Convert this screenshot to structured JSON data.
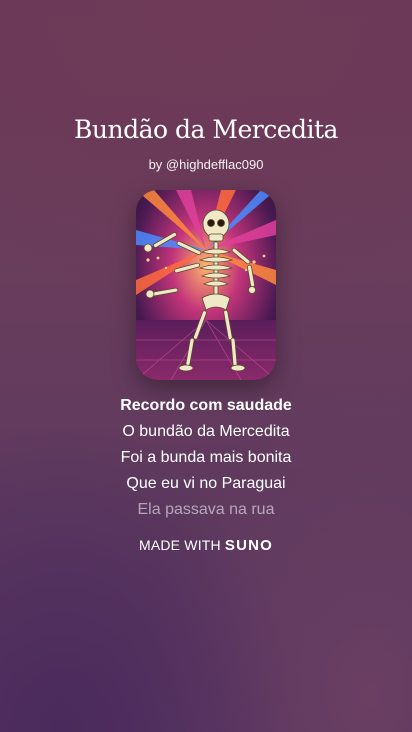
{
  "song": {
    "title": "Bundão da Mercedita",
    "byline": "by @highdefflac090"
  },
  "cover": {
    "description_icon": "dancing-skeleton-artwork",
    "colors": {
      "bg_dark": "#2a1030",
      "ray_orange": "#ff8a3d",
      "ray_pink": "#e0409a",
      "ray_blue": "#4a8cff",
      "bone": "#efe9c8"
    }
  },
  "lyrics": [
    {
      "text": "Recordo com saudade",
      "state": "active"
    },
    {
      "text": "O bundão da Mercedita",
      "state": "normal"
    },
    {
      "text": "Foi a bunda mais bonita",
      "state": "normal"
    },
    {
      "text": "Que eu vi no Paraguai",
      "state": "normal"
    },
    {
      "text": "Ela passava na rua",
      "state": "fade"
    }
  ],
  "footer": {
    "made_with": "MADE WITH",
    "brand": "SUNO"
  }
}
